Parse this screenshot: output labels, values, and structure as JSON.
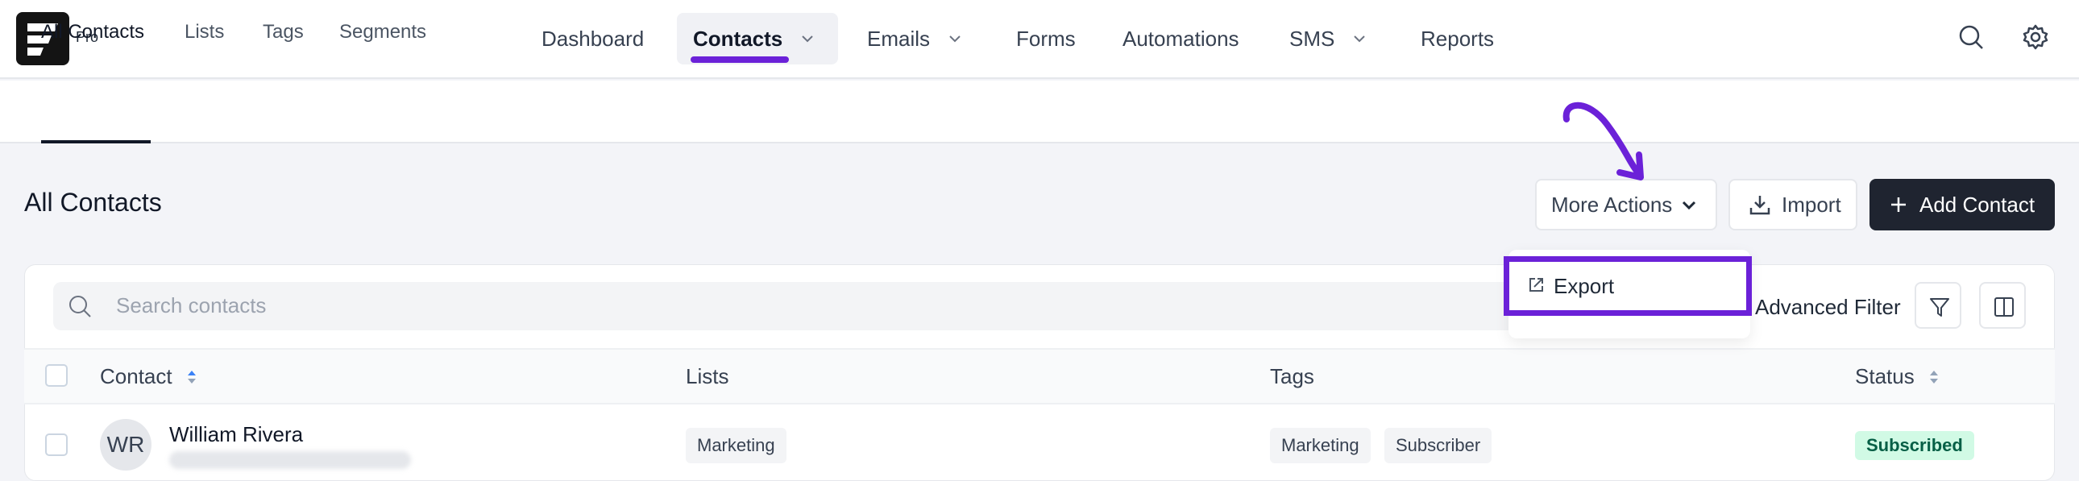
{
  "brand": {
    "badge": "Pro",
    "accent": "#6b21d8"
  },
  "nav": {
    "items": [
      {
        "label": "Dashboard"
      },
      {
        "label": "Contacts",
        "active": true
      },
      {
        "label": "Emails"
      },
      {
        "label": "Forms"
      },
      {
        "label": "Automations"
      },
      {
        "label": "SMS"
      },
      {
        "label": "Reports"
      }
    ]
  },
  "subnav": {
    "items": [
      "All Contacts",
      "Lists",
      "Tags",
      "Segments"
    ],
    "active": "All Contacts"
  },
  "page": {
    "title": "All Contacts"
  },
  "actions": {
    "more_actions": "More Actions",
    "import": "Import",
    "add_contact": "Add Contact"
  },
  "dropdown": {
    "export": "Export"
  },
  "search": {
    "placeholder": "Search contacts"
  },
  "filter": {
    "advanced": "Advanced Filter"
  },
  "table": {
    "columns": [
      "Contact",
      "Lists",
      "Tags",
      "Status"
    ],
    "rows": [
      {
        "initials": "WR",
        "name": "William Rivera",
        "lists": [
          "Marketing"
        ],
        "tags": [
          "Marketing",
          "Subscriber"
        ],
        "status": "Subscribed"
      }
    ]
  }
}
